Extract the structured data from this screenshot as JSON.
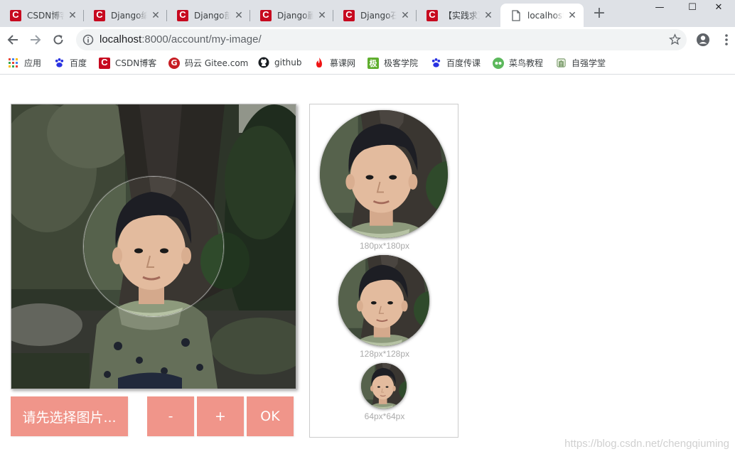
{
  "browser": {
    "tabs": [
      {
        "title": "CSDN博客",
        "favicon": "csdn-icon"
      },
      {
        "title": "Django编",
        "favicon": "csdn-icon"
      },
      {
        "title": "Django部",
        "favicon": "csdn-icon"
      },
      {
        "title": "Django麗",
        "favicon": "csdn-icon"
      },
      {
        "title": "Django石",
        "favicon": "csdn-icon"
      },
      {
        "title": "【实践求】",
        "favicon": "csdn-icon"
      },
      {
        "title": "localhost",
        "favicon": "page-icon",
        "active": true
      }
    ],
    "new_tab": "+",
    "url_host": "localhost",
    "url_rest": ":8000/account/my-image/",
    "bookmarks": [
      {
        "label": "应用",
        "icon": "apps-grid-icon"
      },
      {
        "label": "百度",
        "icon": "baidu-paw-icon"
      },
      {
        "label": "CSDN博客",
        "icon": "csdn-icon"
      },
      {
        "label": "码云 Gitee.com",
        "icon": "gitee-icon"
      },
      {
        "label": "github",
        "icon": "github-icon"
      },
      {
        "label": "慕课网",
        "icon": "imooc-flame-icon"
      },
      {
        "label": "极客学院",
        "icon": "jike-icon"
      },
      {
        "label": "百度传课",
        "icon": "baidu-paw-icon"
      },
      {
        "label": "菜鸟教程",
        "icon": "runoob-icon"
      },
      {
        "label": "自强学堂",
        "icon": "ziqiang-icon"
      }
    ]
  },
  "page": {
    "select_button": "请先选择图片...",
    "zoom_out_button": "-",
    "zoom_in_button": "+",
    "ok_button": "OK",
    "previews": [
      {
        "label": "180px*180px"
      },
      {
        "label": "128px*128px"
      },
      {
        "label": "64px*64px"
      }
    ],
    "watermark": "https://blog.csdn.net/chengqiuming"
  },
  "colors": {
    "button": "#f0958a",
    "tabstrip": "#dee1e6",
    "omnibox": "#f1f3f4",
    "csdn_red": "#c7091f"
  }
}
